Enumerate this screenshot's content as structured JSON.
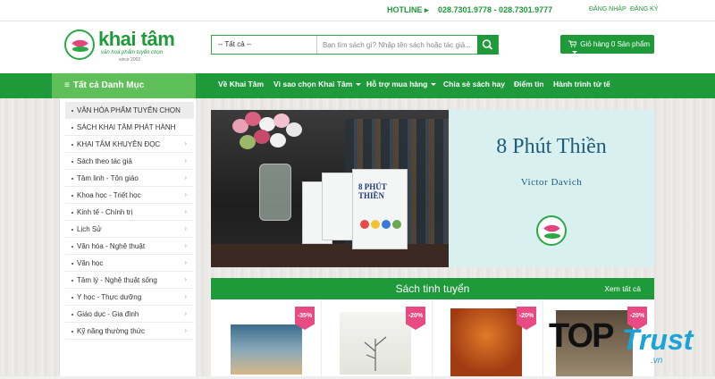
{
  "topbar": {
    "hotline_label": "HOTLINE ▸",
    "hotline_numbers": "028.7301.9778 - 028.7301.9777",
    "login": "ĐĂNG NHẬP",
    "register": "ĐĂNG KÝ"
  },
  "header": {
    "logo_name": "khai tâm",
    "logo_tagline": "văn hoá phẩm tuyển chọn",
    "logo_since": "since 2002",
    "search_category": "-- Tất cả --",
    "search_placeholder": "Bạn tìm sách gì? Nhập tên sách hoặc tác giả...",
    "cart_label": "Giỏ hàng 0 Sản phẩm"
  },
  "nav": {
    "category_label": "Tất cả Danh Mục",
    "items": [
      {
        "label": "Về Khai Tâm"
      },
      {
        "label": "Vì sao chọn Khai Tâm"
      },
      {
        "label": "Hỗ trợ mua hàng"
      },
      {
        "label": "Chia sẻ sách hay"
      },
      {
        "label": "Điểm tin"
      },
      {
        "label": "Hành trình tử tế"
      }
    ]
  },
  "sidebar": {
    "items": [
      {
        "label": "VĂN HÓA PHẨM TUYỂN CHỌN"
      },
      {
        "label": "SÁCH KHAI TÂM PHÁT HÀNH"
      },
      {
        "label": "KHAI TÂM KHUYÊN ĐỌC"
      },
      {
        "label": "Sách theo tác giả"
      },
      {
        "label": "Tâm linh - Tôn giáo"
      },
      {
        "label": "Khoa học - Triết học"
      },
      {
        "label": "Kinh tế - Chính trị"
      },
      {
        "label": "Lịch Sử"
      },
      {
        "label": "Văn hóa - Nghệ thuật"
      },
      {
        "label": "Văn học"
      },
      {
        "label": "Tâm lý - Nghệ thuật sống"
      },
      {
        "label": "Y học - Thực dưỡng"
      },
      {
        "label": "Giáo dục - Gia đình"
      },
      {
        "label": "Kỹ năng thường thức"
      }
    ]
  },
  "banner": {
    "title": "8 Phút Thiền",
    "author": "Victor Davich",
    "book_title": "8 PHÚT THIỀN"
  },
  "section": {
    "title": "Sách tinh tuyển",
    "see_all": "Xem tất cả",
    "products": [
      {
        "discount": "-35%"
      },
      {
        "discount": "-20%"
      },
      {
        "discount": "-20%"
      },
      {
        "discount": "-20%"
      }
    ]
  },
  "watermark": {
    "top": "TOP",
    "trust": "Trust",
    "vn": ".vn"
  },
  "colors": {
    "brand_green": "#1f9a3a",
    "category_green": "#5fc05a",
    "discount_pink": "#e84a82",
    "watermark_blue": "#1aa3d6"
  }
}
